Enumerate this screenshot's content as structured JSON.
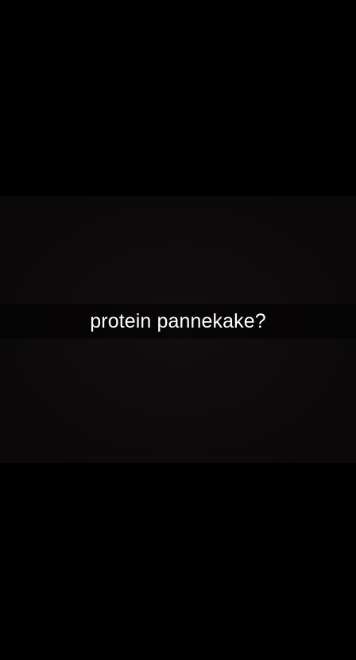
{
  "snap": {
    "caption": "protein pannekake?"
  }
}
